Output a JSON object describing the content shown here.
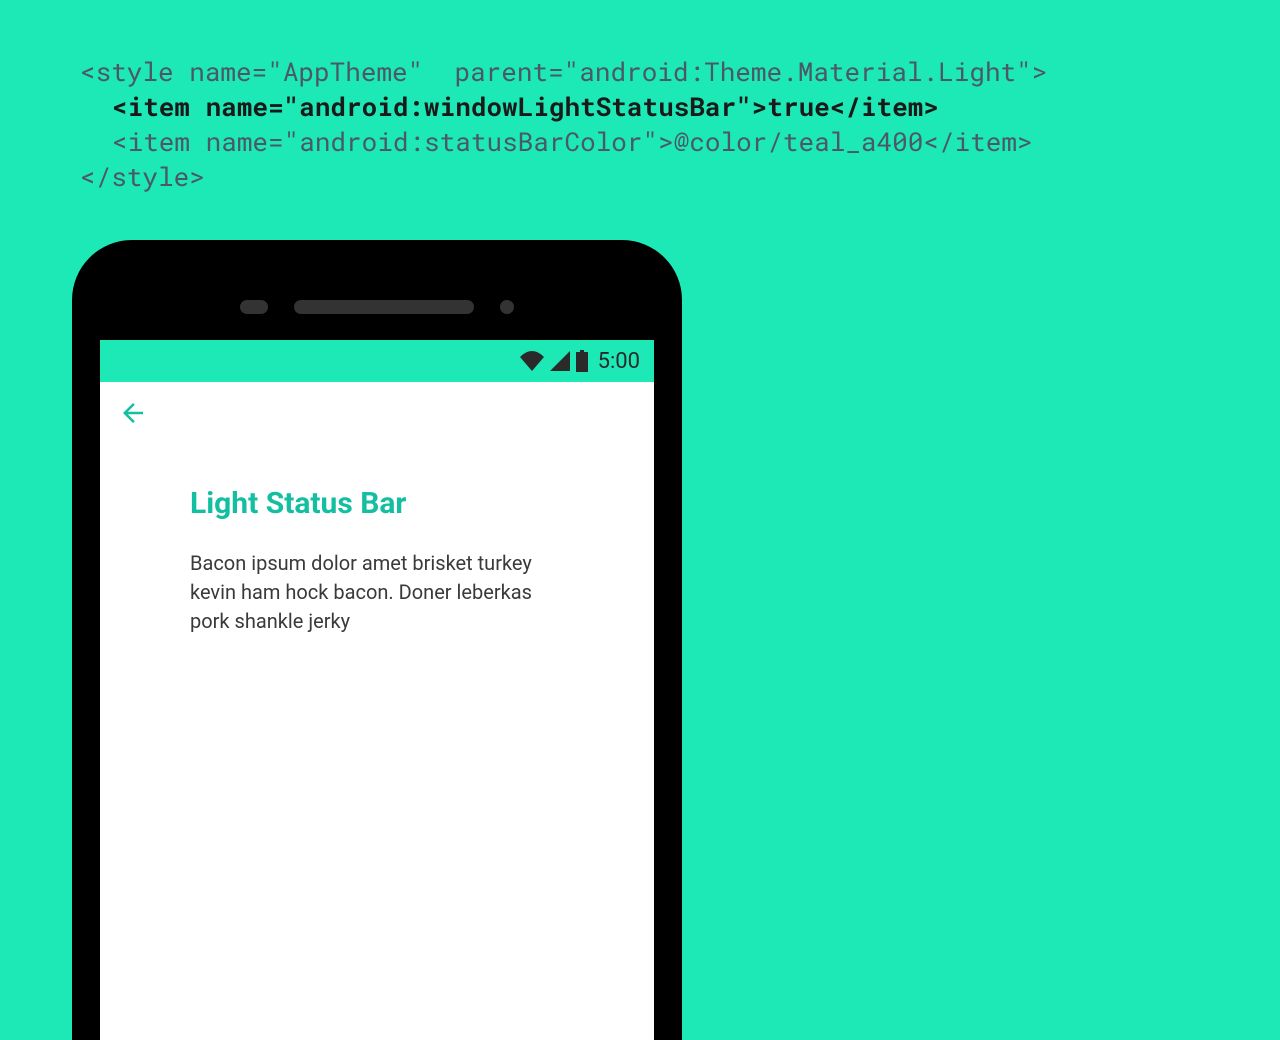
{
  "code": {
    "line1": "<style name=\"AppTheme\"  parent=\"android:Theme.Material.Light\">",
    "line2": "<item name=\"android:windowLightStatusBar\">true</item>",
    "line3": "<item name=\"android:statusBarColor\">@color/teal_a400</item>",
    "line4": "</style>"
  },
  "statusbar": {
    "time": "5:00"
  },
  "content": {
    "heading": "Light Status Bar",
    "body": "Bacon ipsum dolor amet brisket turkey kevin ham hock bacon. Doner leberkas pork shankle jerky"
  }
}
